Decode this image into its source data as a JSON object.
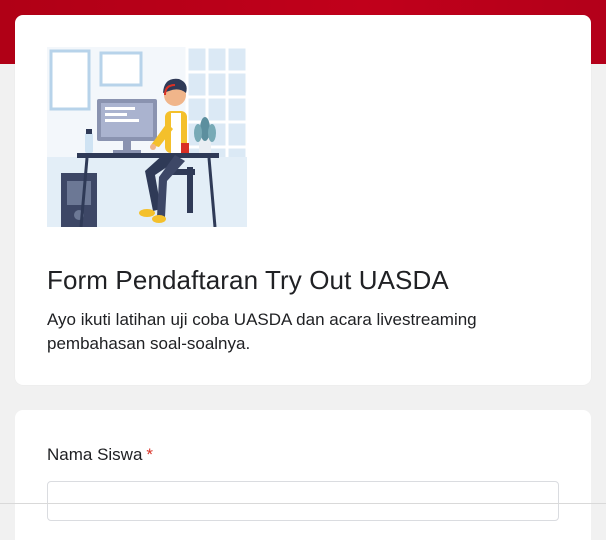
{
  "colors": {
    "brand_band": "#c1001b",
    "page_background": "#f1f1f1",
    "card_background": "#ffffff",
    "required_star": "#d93025"
  },
  "header": {
    "illustration_icon": "person-at-computer-illustration",
    "title": "Form Pendaftaran Try Out UASDA",
    "description": "Ayo ikuti latihan uji coba UASDA dan acara livestreaming pembahasan soal-soalnya."
  },
  "question": {
    "label": "Nama Siswa",
    "required_marker": "*",
    "value": ""
  }
}
